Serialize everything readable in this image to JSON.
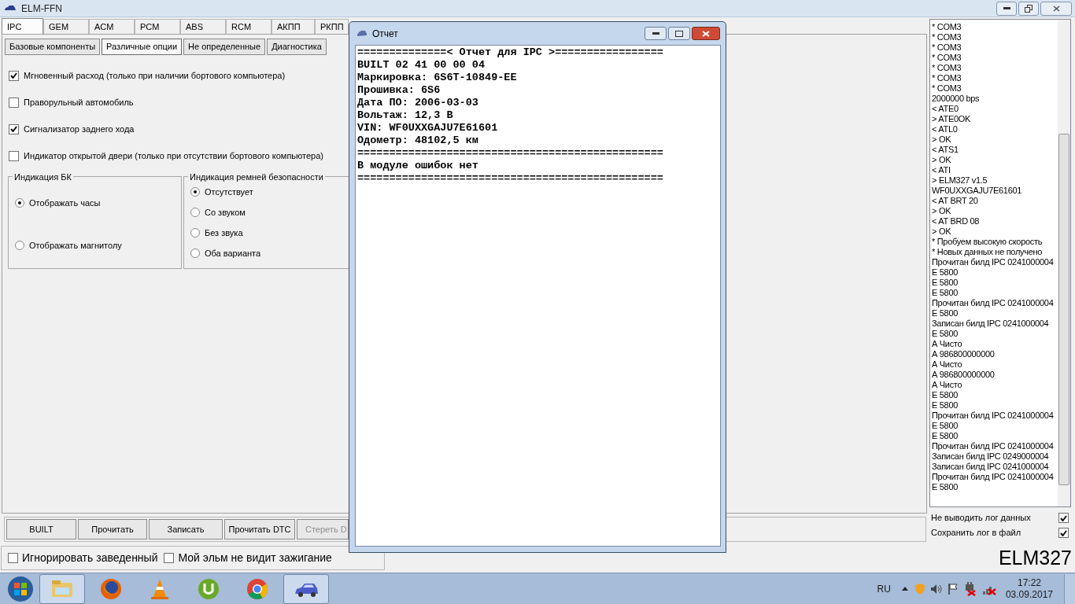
{
  "window": {
    "title": "ELM-FFN"
  },
  "tabs": [
    {
      "label": "IPC",
      "selected": true
    },
    {
      "label": "GEM",
      "selected": false
    },
    {
      "label": "ACM",
      "selected": false
    },
    {
      "label": "PCM",
      "selected": false
    },
    {
      "label": "ABS",
      "selected": false
    },
    {
      "label": "RCM",
      "selected": false
    },
    {
      "label": "АКПП",
      "selected": false
    },
    {
      "label": "РКПП",
      "selected": false
    }
  ],
  "subtabs": [
    {
      "label": "Базовые компоненты",
      "selected": false
    },
    {
      "label": "Различные опции",
      "selected": true
    },
    {
      "label": "Не определенные",
      "selected": false
    },
    {
      "label": "Диагностика",
      "selected": false
    }
  ],
  "options": [
    {
      "label": "Мгновенный расход (только при наличии бортового компьютера)",
      "checked": true
    },
    {
      "label": "Праворульный автомобиль",
      "checked": false
    },
    {
      "label": "Сигнализатор заднего хода",
      "checked": true
    },
    {
      "label": "Индикатор открытой двери (только при отсутствии бортового компьютера)",
      "checked": false
    }
  ],
  "groups": [
    {
      "title": "Индикация БК",
      "options": [
        {
          "label": "Отображать часы",
          "selected": true
        },
        {
          "label": "Отображать магнитолу",
          "selected": false
        }
      ]
    },
    {
      "title": "Индикация ремней безопасности",
      "options": [
        {
          "label": "Отсутствует",
          "selected": true
        },
        {
          "label": "Со звуком",
          "selected": false
        },
        {
          "label": "Без звука",
          "selected": false
        },
        {
          "label": "Оба варианта",
          "selected": false
        }
      ]
    }
  ],
  "action_buttons": [
    {
      "label": "BUILT",
      "disabled": false
    },
    {
      "label": "Прочитать",
      "disabled": false
    },
    {
      "label": "Записать",
      "disabled": false
    },
    {
      "label": "Прочитать DTC",
      "disabled": false
    },
    {
      "label": "Стереть D",
      "disabled": true
    }
  ],
  "bottom_options": [
    {
      "label": "Игнорировать заведенный",
      "checked": false
    },
    {
      "label": "Мой эльм не видит зажигание",
      "checked": false
    }
  ],
  "log": {
    "lines": [
      "* COM3",
      "* COM3",
      "* COM3",
      "* COM3",
      "* COM3",
      "* COM3",
      "* COM3",
      "2000000 bps",
      "< ATE0",
      "> ATE0OK",
      "< ATL0",
      "> OK",
      "< ATS1",
      "> OK",
      "< ATI",
      "> ELM327 v1.5",
      "WF0UXXGAJU7E61601",
      "< AT BRT 20",
      "> OK",
      "< AT BRD 08",
      "> OK",
      "* Пробуем высокую скорость",
      "* Новых данных не получено",
      "Прочитан билд IPC 0241000004",
      "E 5800",
      "E 5800",
      "E 5800",
      "Прочитан билд IPC 0241000004",
      "E 5800",
      "Записан билд IPC 0241000004",
      "E 5800",
      "А Чисто",
      "А 986800000000",
      "А Чисто",
      "А 986800000000",
      "А Чисто",
      "E 5800",
      "E 5800",
      "Прочитан билд IPC 0241000004",
      "E 5800",
      "E 5800",
      "Прочитан билд IPC 0241000004",
      "Записан билд IPC 0249000004",
      "Записан билд IPC 0241000004",
      "Прочитан билд IPC 0241000004",
      "E 5800"
    ]
  },
  "log_options": [
    {
      "label": "Не выводить лог данных",
      "checked": true
    },
    {
      "label": "Сохранить лог в файл",
      "checked": true
    }
  ],
  "adapter_label": "ELM327",
  "report_dialog": {
    "title": "Отчет",
    "lines": [
      "==============< Отчет для IPC >=================",
      "BUILT 02 41 00 00 04",
      "Маркировка: 6S6T-10849-EE",
      "Прошивка: 6S6",
      "Дата ПО: 2006-03-03",
      "Вольтаж: 12,3 В",
      "VIN: WF0UXXGAJU7E61601",
      "Одометр: 48102,5 км",
      "================================================",
      "В модуле ошибок нет",
      "================================================"
    ]
  },
  "taskbar": {
    "apps": [
      {
        "kind": "folder",
        "active": true
      },
      {
        "kind": "firefox",
        "active": false
      },
      {
        "kind": "cone",
        "active": false
      },
      {
        "kind": "torrent",
        "active": false
      },
      {
        "kind": "chrome",
        "active": false
      },
      {
        "kind": "car",
        "active": true
      }
    ]
  },
  "tray": {
    "language": "RU",
    "time": "17:22",
    "date": "03.09.2017"
  }
}
